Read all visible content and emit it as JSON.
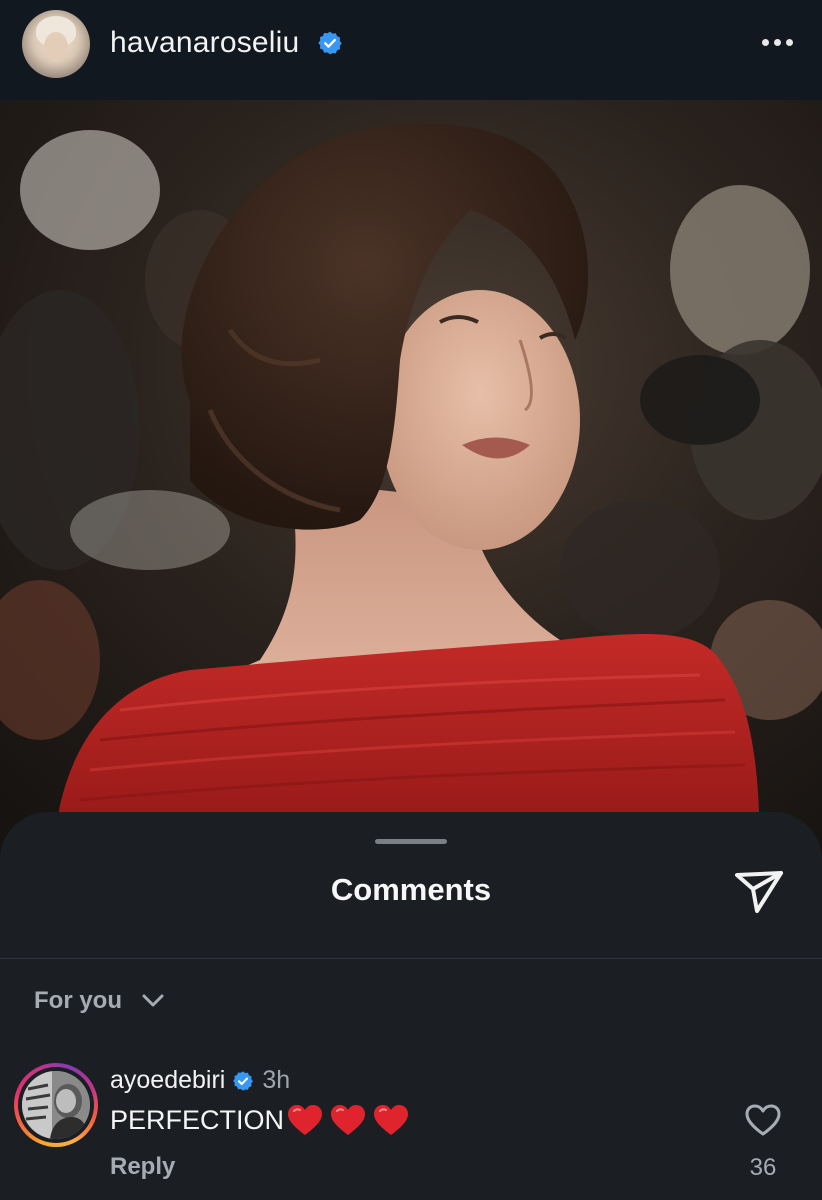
{
  "post": {
    "username": "havanaroseliu",
    "verified_icon": "verified-badge-icon",
    "more_icon": "more-horizontal-icon",
    "photo_icon": "portrait-photo"
  },
  "sheet": {
    "title": "Comments",
    "share_icon": "send-paper-plane-icon",
    "filter_label": "For you",
    "filter_icon": "chevron-down-icon"
  },
  "comments": [
    {
      "username": "ayoedebiri",
      "verified": true,
      "time": "3h",
      "text": "PERFECTION",
      "emoji": [
        "red-heart",
        "red-heart",
        "red-heart"
      ],
      "reply_label": "Reply",
      "like_count": "36",
      "like_icon": "heart-outline-icon"
    }
  ],
  "colors": {
    "background": "#12171c",
    "sheet": "#1b1f24",
    "verified_blue": "#3897f0",
    "secondary_text": "#a7acb2",
    "heart_red": "#e0242e",
    "dress_red": "#b4201f"
  }
}
